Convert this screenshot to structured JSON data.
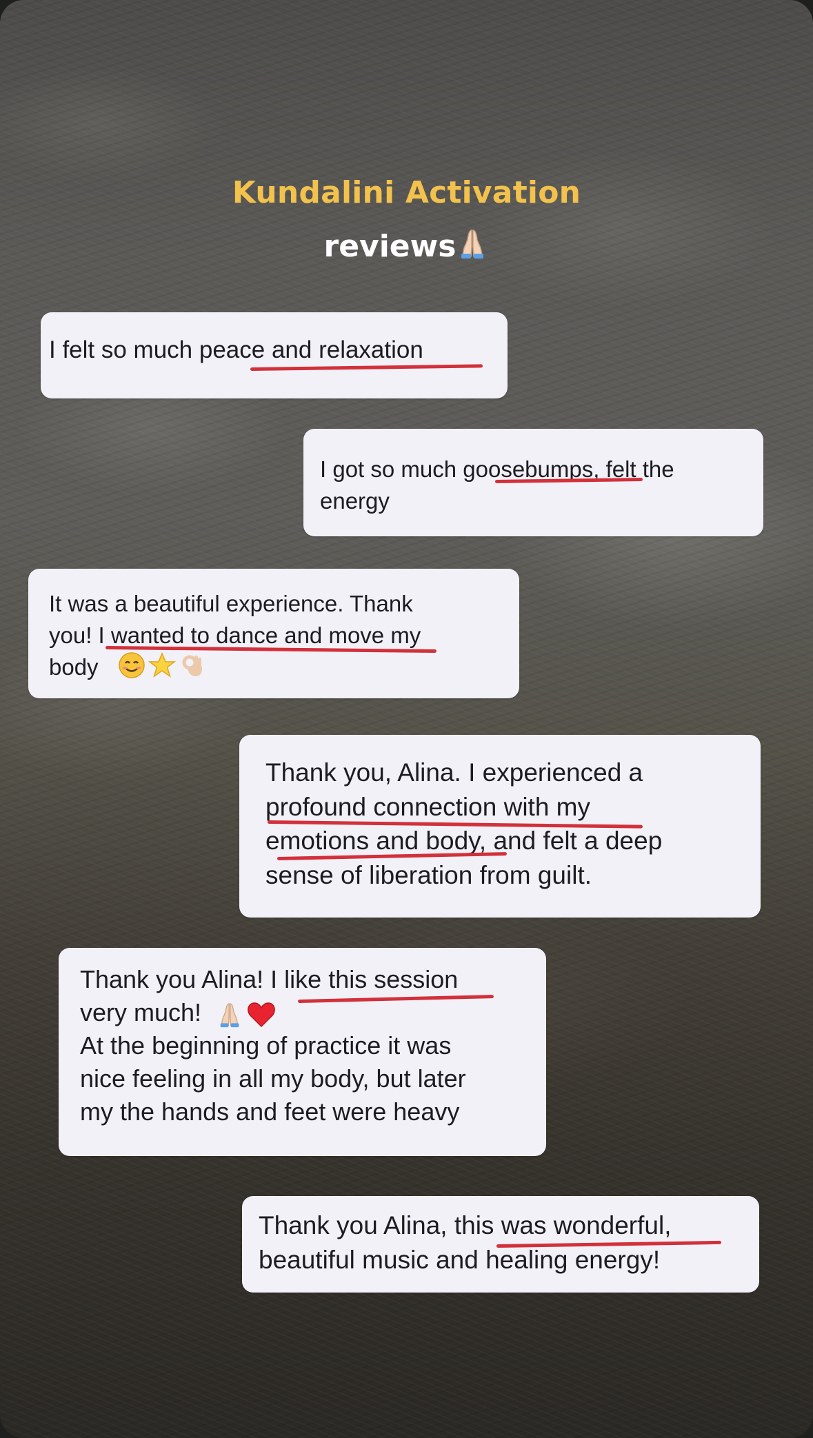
{
  "header": {
    "title": "Kundalini Activation",
    "subtitle": "reviews",
    "subtitle_icon": "folded-hands-icon"
  },
  "reviews": [
    {
      "text": "I felt so much peace and relaxation",
      "highlight": "peace and relaxation",
      "align": "left"
    },
    {
      "text": "I got so much goosebumps, felt the\nenergy",
      "highlight": "goosebumps",
      "align": "right"
    },
    {
      "text": "It was a beautiful experience. Thank\nyou! I wanted to dance and move my\nbody",
      "highlight": "I wanted to dance and move",
      "icons": [
        "smiling-face-icon",
        "star-icon",
        "ok-hand-icon"
      ],
      "align": "left"
    },
    {
      "text": "Thank you, Alina. I experienced a\nprofound connection with my\nemotions and body, and felt a deep\nsense of liberation from guilt.",
      "highlight": "profound connection with my emotions and body",
      "align": "right"
    },
    {
      "text": "Thank you Alina! I like this session\nvery much!\nAt the beginning of practice it was\nnice feeling in all my body, but later\nmy the hands and feet were heavy",
      "highlight": "like this session",
      "icons": [
        "folded-hands-icon",
        "red-heart-icon"
      ],
      "align": "left"
    },
    {
      "text": "Thank you Alina, this was wonderful,\nbeautiful music and healing energy!",
      "highlight": "this was wonderful",
      "align": "right"
    }
  ],
  "colors": {
    "title": "#f2c24d",
    "subtitle": "#ffffff",
    "bubble": "#f2f1f7",
    "text": "#1c1c22",
    "underline": "#d2303a"
  }
}
